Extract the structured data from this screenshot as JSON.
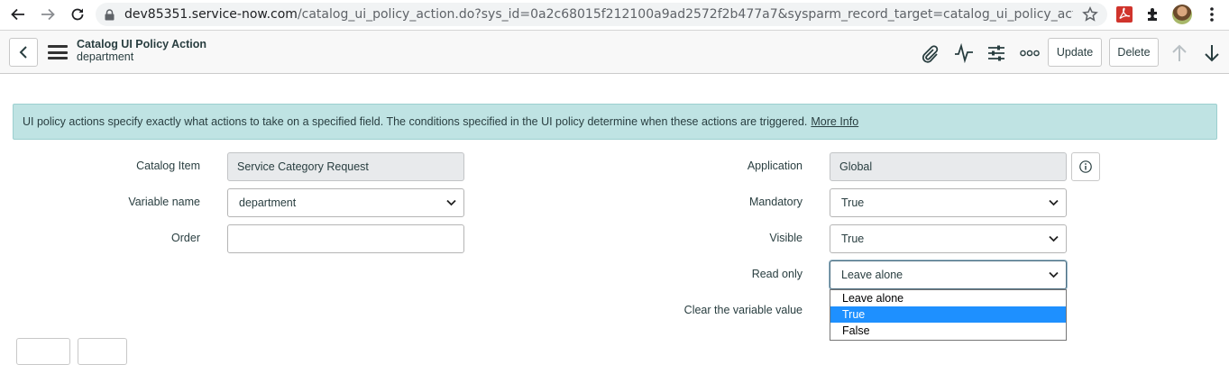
{
  "browser": {
    "url_host": "dev85351.service-now.com",
    "url_path": "/catalog_ui_policy_action.do?sys_id=0a2c68015f212100a9ad2572f2b477a7&sysparm_record_target=catalog_ui_policy_action&sysparm_reco..."
  },
  "header": {
    "title": "Catalog UI Policy Action",
    "subtitle": "department",
    "update_label": "Update",
    "delete_label": "Delete"
  },
  "banner": {
    "text": "UI policy actions specify exactly what actions to take on a specified field. The conditions specified in the UI policy determine when these actions are triggered.",
    "link": "More Info"
  },
  "form": {
    "catalog_item": {
      "label": "Catalog Item",
      "value": "Service Category Request"
    },
    "variable_name": {
      "label": "Variable name",
      "value": "department"
    },
    "order": {
      "label": "Order",
      "value": ""
    },
    "application": {
      "label": "Application",
      "value": "Global"
    },
    "mandatory": {
      "label": "Mandatory",
      "value": "True"
    },
    "visible": {
      "label": "Visible",
      "value": "True"
    },
    "read_only": {
      "label": "Read only",
      "value": "Leave alone",
      "options": [
        "Leave alone",
        "True",
        "False"
      ],
      "highlighted": "True"
    },
    "clear_value": {
      "label": "Clear the variable value"
    }
  },
  "colors": {
    "banner_bg": "#bfe3e3",
    "highlight": "#1e90ff",
    "readonly_bg": "#e8eaec"
  }
}
